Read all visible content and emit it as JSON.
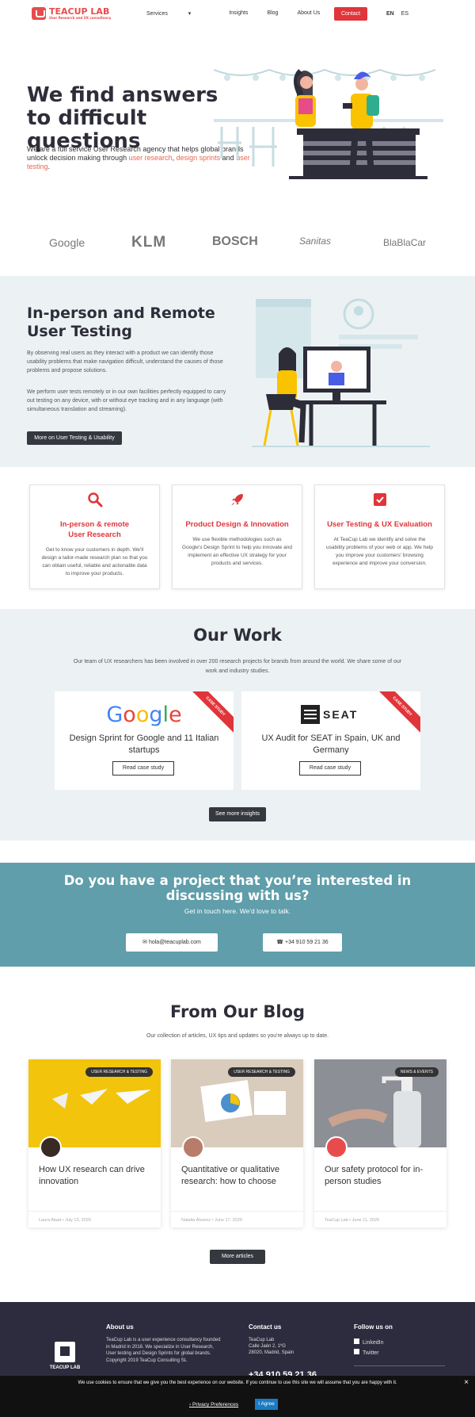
{
  "header": {
    "logo_name": "TEACUP LAB",
    "logo_tagline": "User Research and UX consultancy",
    "nav": [
      "Services",
      "Insights",
      "Blog",
      "About Us"
    ],
    "contact_label": "Contact",
    "lang_en": "EN",
    "lang_es": "ES"
  },
  "hero": {
    "title": "We find answers to difficult questions",
    "text_a": "We are a full service User Research agency that helps global brands unlock decision making through ",
    "link1": "user research",
    "sep1": ", ",
    "link2": "design sprints",
    "sep2": " and ",
    "link3": "user testing",
    "end": "."
  },
  "clients": [
    "Google",
    "KLM",
    "BOSCH",
    "Sanitas",
    "BlaBlaCar"
  ],
  "testing": {
    "title": "In-person and Remote User Testing",
    "p1": "By observing real users as they interact with a product we can identify those usability problems that make navigation difficult, understand the causes of those problems and propose solutions.",
    "p2": "We perform user tests remotely or in our own facilities perfectly equipped to carry out testing on any device, with or without eye tracking and in any language (with simultaneous translation and streaming).",
    "button": "More on User Testing & Usability"
  },
  "services": [
    {
      "title": "In-person & remote User Research",
      "text": "Get to know your customers in depth. We'll design a tailor-made research plan so that you can obtain useful, reliable and actionable data to improve your products."
    },
    {
      "title": "Product Design & Innovation",
      "text": "We use flexible methodologies such as Google's Design Sprint to help you innovate and implement an effective UX strategy for your products and services."
    },
    {
      "title": "User Testing & UX Evaluation",
      "text": "At TeaCup Lab we identify and solve the usability problems of your web or app. We help you improve your customers' browsing experience and improve your conversion."
    }
  ],
  "work": {
    "title": "Our Work",
    "text": "Our team of UX researchers has been involved in over 200 research projects for brands from around the world. We share some of our work and industry studies.",
    "ribbon": "CASE STUDY",
    "cases": [
      {
        "logo": "Google",
        "title": "Design Sprint for Google and 11 Italian startups",
        "button": "Read case study"
      },
      {
        "logo": "SEAT",
        "title": "UX Audit for SEAT in Spain, UK and Germany",
        "button": "Read case study"
      }
    ],
    "more": "See more insights"
  },
  "cta": {
    "title": "Do you have a project that you’re interested in discussing with us?",
    "text": "Get in touch here. We'd love to talk.",
    "email": "hola@teacuplab.com",
    "phone": "+34 910 59 21 36"
  },
  "blog": {
    "title": "From Our Blog",
    "text": "Our collection of articles, UX tips and updates so you're always up to date.",
    "posts": [
      {
        "tag": "USER RESEARCH & TESTING",
        "title": "How UX research can drive innovation",
        "author": "Laura Abad",
        "date": "July 13, 2020"
      },
      {
        "tag": "USER RESEARCH & TESTING",
        "title": "Quantitative or qualitative research: how to choose",
        "author": "Natalia Álvarez",
        "date": "June 17, 2020"
      },
      {
        "tag": "NEWS & EVENTS",
        "title": "Our safety protocol for in-person studies",
        "author": "TeaCup Lab",
        "date": "June 11, 2020"
      }
    ],
    "more": "More articles"
  },
  "footer": {
    "logo_name": "TEACUP LAB",
    "about_title": "About us",
    "about_text": "TeaCup Lab is a user experience consultancy founded in Madrid in 2016. We specialize in User Research, User testing and Design Sprints for global brands.",
    "copyright": "Copyright 2019 TeaCup Consulting SL",
    "contact_title": "Contact us",
    "address1": "TeaCup Lab",
    "address2": "Calle Jaén 2, 1ºG",
    "address3": "28020, Madrid, Spain",
    "phone": "+34 910 59 21 36",
    "follow_title": "Follow us on",
    "social": [
      "LinkedIn",
      "Twitter"
    ]
  },
  "cookie": {
    "text": "We use cookies to ensure that we give you the best experience on our website. If you continue to use this site we will assume that you are happy with it.",
    "prefs": "Privacy Preferences",
    "agree": "I Agree",
    "close": "×"
  },
  "colors": {
    "accent": "#e0353a",
    "cta_bg": "#5f9eaa",
    "light_bg": "#ecf2f4",
    "footer_bg": "#2c2c3e"
  }
}
